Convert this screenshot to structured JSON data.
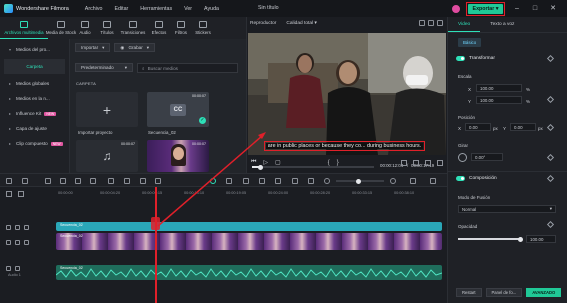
{
  "app": {
    "name": "Wondershare Filmora",
    "doc_title": "Sin título"
  },
  "menu": [
    "Archivo",
    "Editar",
    "Herramientas",
    "Ver",
    "Ayuda"
  ],
  "export_label": "Exportar",
  "toolbar": [
    {
      "label": "Archivos multimedia",
      "icon": "media-icon"
    },
    {
      "label": "Media de Stock",
      "icon": "stock-icon"
    },
    {
      "label": "Audio",
      "icon": "music-icon"
    },
    {
      "label": "Títulos",
      "icon": "title-icon"
    },
    {
      "label": "Transiciones",
      "icon": "transition-icon"
    },
    {
      "label": "Efectos",
      "icon": "effects-icon"
    },
    {
      "label": "Filtros",
      "icon": "filter-icon"
    },
    {
      "label": "Stickers",
      "icon": "sticker-icon"
    }
  ],
  "sidebar": [
    {
      "label": "Medios del pro..."
    },
    {
      "label": "Carpeta"
    },
    {
      "label": "Medios globales"
    },
    {
      "label": "Medios en la n..."
    },
    {
      "label": "Influence Kit",
      "badge": "NEW"
    },
    {
      "label": "Capa de ajuste"
    },
    {
      "label": "Clip compuesto",
      "badge": "NEW"
    }
  ],
  "media": {
    "import_label": "Importar",
    "record_label": "Grabar",
    "filter_label": "Predeterminado",
    "search_placeholder": "Buscar medios",
    "section": "CARPETA",
    "tiles": [
      {
        "label": "Importar proyecto",
        "kind": "import"
      },
      {
        "label": "Secuencia_02",
        "kind": "cc",
        "duration": "00:00:07"
      },
      {
        "label": "",
        "kind": "audio",
        "duration": "00:00:07"
      },
      {
        "label": "",
        "kind": "video",
        "duration": "00:00:07"
      }
    ]
  },
  "player": {
    "tab": "Reproductor",
    "quality": "Calidad total",
    "subtitle": "are in public places or because they co... during business hours.",
    "time_current": "00:00:12:04",
    "time_total": "00:00:17:19"
  },
  "inspector": {
    "tabs": [
      "Video",
      "Texto a voz"
    ],
    "pill": "Básico",
    "transform": "Transformar",
    "escala": "Escala",
    "x_label": "X",
    "y_label": "Y",
    "scale_x": "100.00",
    "scale_y": "100.00",
    "scale_unit": "%",
    "posicion": "Posición",
    "pos_x": "0.00",
    "pos_y": "0.00",
    "pos_unit": "px",
    "girar": "Girar",
    "rotate": "0.00°",
    "composicion": "Composición",
    "blend_label": "Modo de Fusión",
    "blend_value": "Normal",
    "opacity_label": "Opacidad",
    "opacity_value": "100.00",
    "opacity_fraction": 1.0,
    "reset": "Restart",
    "keyframe": "Panel de fo...",
    "advanced": "AVANZADO"
  },
  "timeline": {
    "ruler": [
      "00:00:00",
      "00:00:04:20",
      "00:00:09:15",
      "00:00:14:10",
      "00:00:19:05",
      "00:00:24:00",
      "00:00:28:20",
      "00:00:33:15",
      "00:00:38:10",
      "00:00:43:05"
    ],
    "tracks": [
      {
        "name": "Secuencia_02",
        "kind": "sequence"
      },
      {
        "name": "Secuencia_02",
        "kind": "video"
      },
      {
        "name": "Secuencia_02",
        "kind": "audio",
        "label": "Audio 1"
      }
    ]
  }
}
